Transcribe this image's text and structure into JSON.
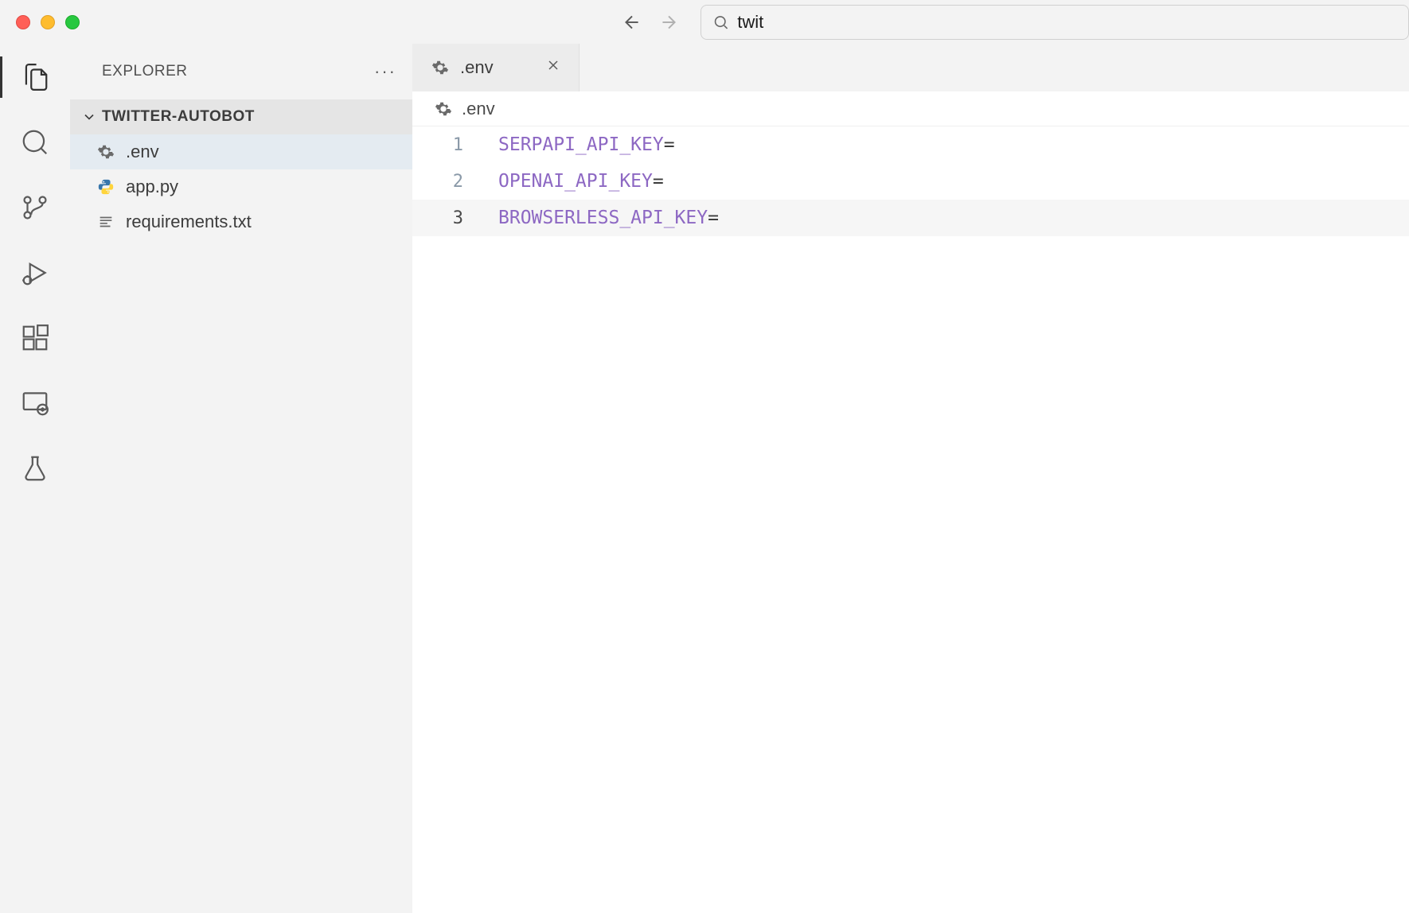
{
  "search": {
    "value": "twit"
  },
  "sidebar": {
    "title": "EXPLORER",
    "project": "TWITTER-AUTOBOT",
    "files": [
      {
        "name": ".env",
        "icon": "gear",
        "selected": true
      },
      {
        "name": "app.py",
        "icon": "python",
        "selected": false
      },
      {
        "name": "requirements.txt",
        "icon": "lines",
        "selected": false
      }
    ]
  },
  "tabs": [
    {
      "name": ".env",
      "icon": "gear"
    }
  ],
  "breadcrumb": {
    "icon": "gear",
    "name": ".env"
  },
  "editor": {
    "currentLine": 3,
    "lines": [
      {
        "num": "1",
        "key": "SERPAPI_API_KEY",
        "rest": "="
      },
      {
        "num": "2",
        "key": "OPENAI_API_KEY",
        "rest": "="
      },
      {
        "num": "3",
        "key": "BROWSERLESS_API_KEY",
        "rest": "="
      }
    ]
  }
}
